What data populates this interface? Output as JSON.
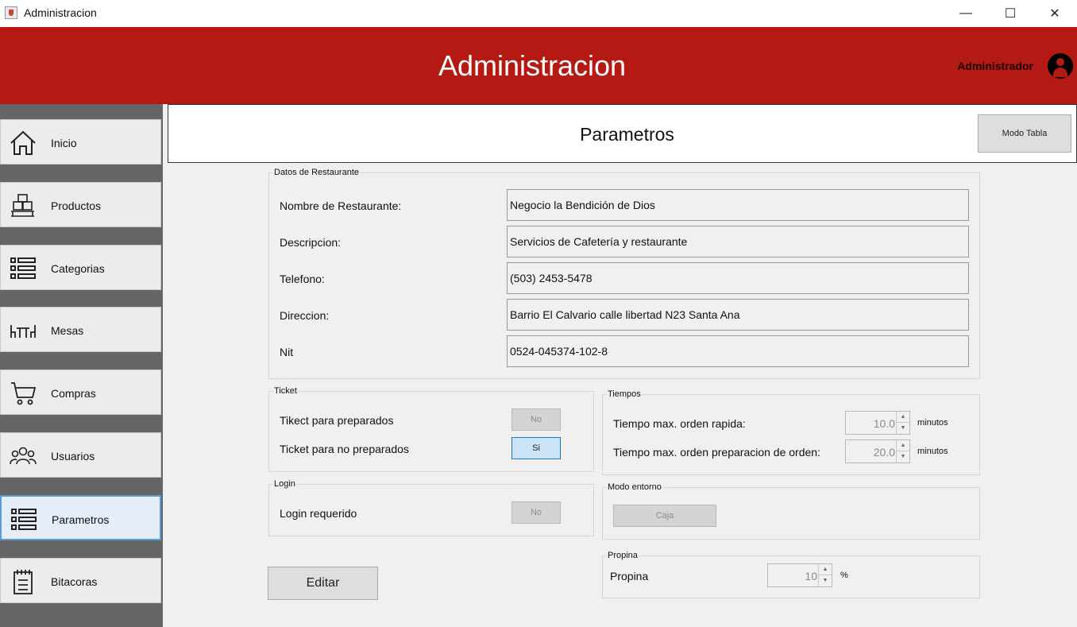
{
  "window": {
    "title": "Administracion",
    "controls": [
      "—",
      "☐",
      "✕"
    ]
  },
  "header": {
    "title": "Administracion",
    "user": "Administrador"
  },
  "sidebar": {
    "items": [
      {
        "label": "Inicio",
        "icon": "home-icon"
      },
      {
        "label": "Productos",
        "icon": "boxes-icon"
      },
      {
        "label": "Categorias",
        "icon": "list-icon"
      },
      {
        "label": "Mesas",
        "icon": "table-chairs-icon"
      },
      {
        "label": "Compras",
        "icon": "cart-icon"
      },
      {
        "label": "Usuarios",
        "icon": "users-icon"
      },
      {
        "label": "Parametros",
        "icon": "list-icon",
        "active": true
      },
      {
        "label": "Bitacoras",
        "icon": "clipboard-icon"
      }
    ]
  },
  "page": {
    "title": "Parametros",
    "mode_button": "Modo Tabla"
  },
  "datos": {
    "title": "Datos de Restaurante",
    "fields": [
      {
        "label": "Nombre de Restaurante:",
        "value": "Negocio la Bendición de Dios"
      },
      {
        "label": "Descripcion:",
        "value": "Servicios de Cafetería y restaurante"
      },
      {
        "label": "Telefono:",
        "value": "(503) 2453-5478"
      },
      {
        "label": "Direccion:",
        "value": "Barrio El Calvario calle libertad N23 Santa Ana"
      },
      {
        "label": "Nit",
        "value": "0524-045374-102-8"
      }
    ]
  },
  "ticket": {
    "title": "Ticket",
    "preparados_label": "Tikect para preparados",
    "preparados_value": "No",
    "no_preparados_label": "Ticket para no preparados",
    "no_preparados_value": "Si"
  },
  "tiempos": {
    "title": "Tiempos",
    "rapida_label": "Tiempo max. orden rapida:",
    "rapida_value": "10.0",
    "preparacion_label": "Tiempo max. orden preparacion de orden:",
    "preparacion_value": "20.0",
    "unit": "minutos"
  },
  "login": {
    "title": "Login",
    "label": "Login requerido",
    "value": "No"
  },
  "modo": {
    "title": "Modo entorno",
    "value": "Caja"
  },
  "propina": {
    "title": "Propina",
    "label": "Propina",
    "value": "10",
    "unit": "%"
  },
  "actions": {
    "edit_label": "Editar"
  },
  "colors": {
    "header": "#b51914",
    "sidebar": "#656565",
    "active_border": "#5a9bd8"
  }
}
